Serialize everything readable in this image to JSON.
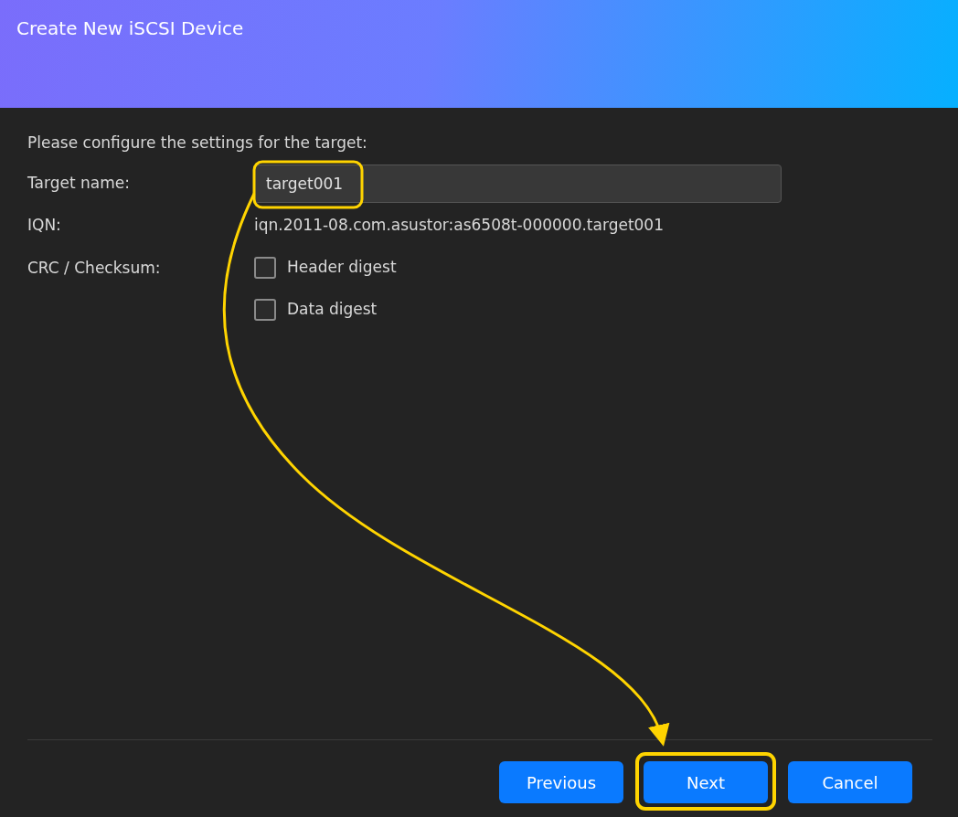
{
  "window": {
    "title": "Create New iSCSI Device"
  },
  "intro": "Please configure the settings for the target:",
  "target_name": {
    "label": "Target name:",
    "value": "target001"
  },
  "iqn": {
    "label": "IQN:",
    "value": "iqn.2011-08.com.asustor:as6508t-000000.target001"
  },
  "crc": {
    "label": "CRC / Checksum:",
    "options": [
      {
        "label": "Header digest",
        "checked": false
      },
      {
        "label": "Data digest",
        "checked": false
      }
    ]
  },
  "buttons": [
    {
      "label": "Previous"
    },
    {
      "label": "Next"
    },
    {
      "label": "Cancel"
    }
  ]
}
